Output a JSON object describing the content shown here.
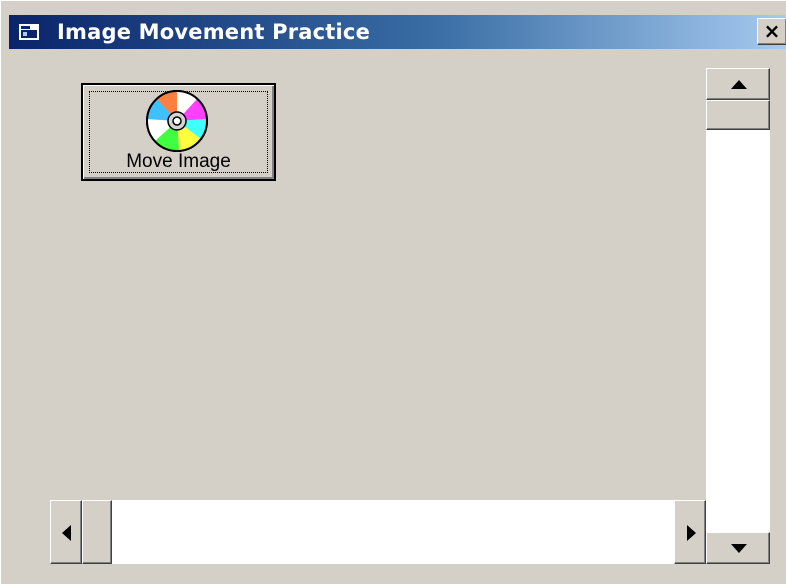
{
  "window": {
    "title": "Image Movement Practice",
    "close_glyph": "✕"
  },
  "button": {
    "label": "Move Image",
    "icon": "cd-disc-icon"
  },
  "scrollbars": {
    "vertical": {
      "up": "scroll-up-arrow",
      "down": "scroll-down-arrow"
    },
    "horizontal": {
      "left": "scroll-left-arrow",
      "right": "scroll-right-arrow"
    }
  },
  "colors": {
    "face": "#d4d0c8",
    "title_start": "#0a246a",
    "title_end": "#a6caf0"
  }
}
